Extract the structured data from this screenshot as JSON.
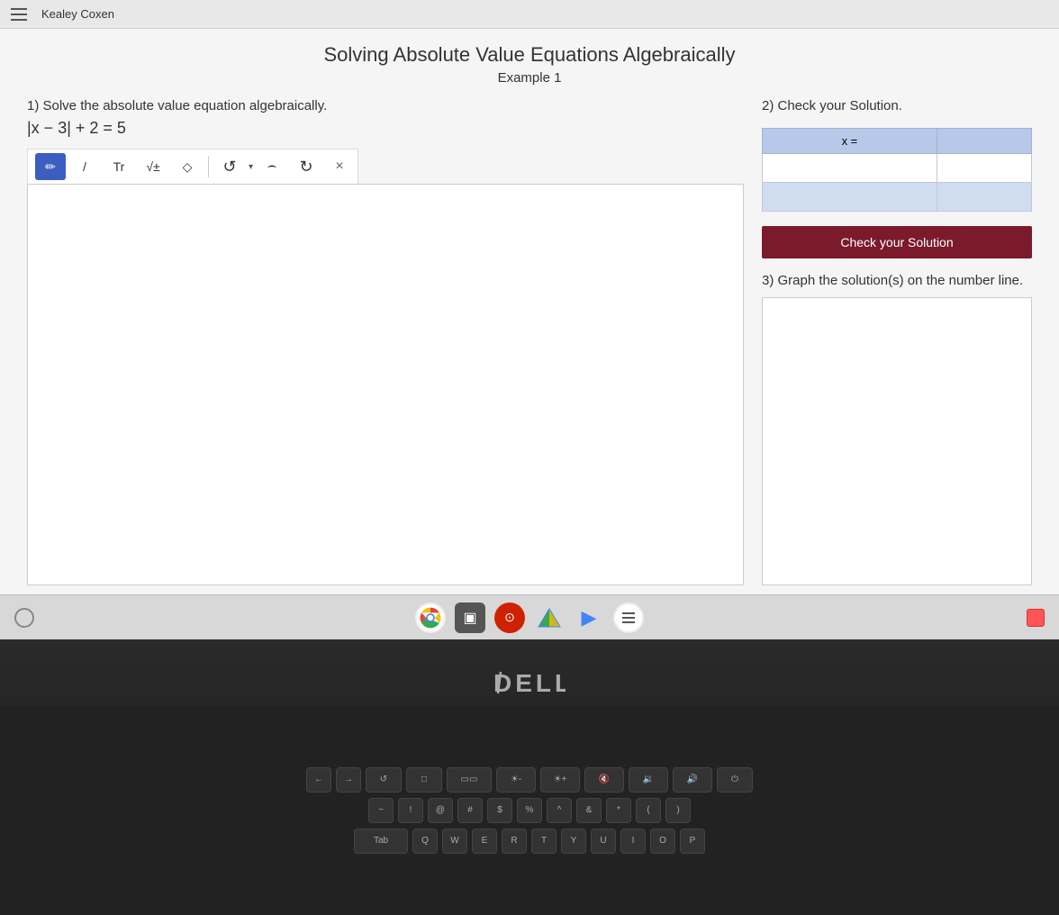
{
  "app": {
    "user": "Kealey Coxen",
    "title": "Solving Absolute Value Equations Algebraically",
    "example_label": "Example 1"
  },
  "left_section": {
    "problem_label": "1) Solve the absolute value equation algebraically.",
    "equation": "|x − 3| + 2 = 5"
  },
  "toolbar": {
    "tools": [
      {
        "id": "pen",
        "label": "✏",
        "active": true
      },
      {
        "id": "line",
        "label": "/",
        "active": false
      },
      {
        "id": "text",
        "label": "Tr",
        "active": false
      },
      {
        "id": "math",
        "label": "√±",
        "active": false
      },
      {
        "id": "eraser",
        "label": "◇",
        "active": false
      },
      {
        "id": "undo",
        "label": "↺",
        "active": false
      }
    ],
    "close_label": "×"
  },
  "right_section": {
    "check_title": "2) Check your Solution.",
    "table_header": "x =",
    "check_button_label": "Check your Solution",
    "graph_title": "3) Graph the solution(s) on the number line."
  },
  "taskbar": {
    "icons": [
      {
        "id": "chrome",
        "label": "Chrome"
      },
      {
        "id": "tv",
        "label": "Screen"
      },
      {
        "id": "vpn",
        "label": "VPN"
      },
      {
        "id": "drive",
        "label": "Drive"
      },
      {
        "id": "play",
        "label": "Play"
      },
      {
        "id": "menu",
        "label": "Menu"
      }
    ]
  },
  "dell_logo": "DELL"
}
